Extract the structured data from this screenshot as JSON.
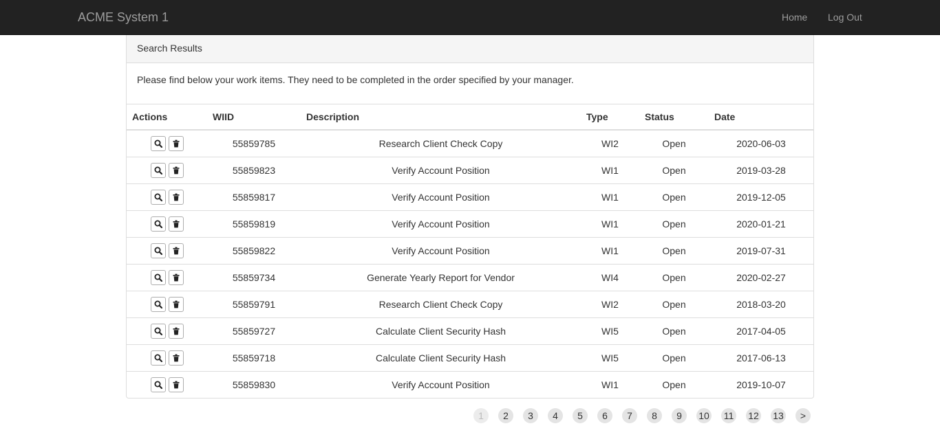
{
  "navbar": {
    "brand": "ACME System 1",
    "links": [
      {
        "label": "Home"
      },
      {
        "label": "Log Out"
      }
    ]
  },
  "panel": {
    "heading": "Search Results",
    "body_text": "Please find below your work items. They need to be completed in the order specified by your manager."
  },
  "table": {
    "columns": [
      "Actions",
      "WIID",
      "Description",
      "Type",
      "Status",
      "Date"
    ],
    "rows": [
      {
        "wiid": "55859785",
        "description": "Research Client Check Copy",
        "type": "WI2",
        "status": "Open",
        "date": "2020-06-03"
      },
      {
        "wiid": "55859823",
        "description": "Verify Account Position",
        "type": "WI1",
        "status": "Open",
        "date": "2019-03-28"
      },
      {
        "wiid": "55859817",
        "description": "Verify Account Position",
        "type": "WI1",
        "status": "Open",
        "date": "2019-12-05"
      },
      {
        "wiid": "55859819",
        "description": "Verify Account Position",
        "type": "WI1",
        "status": "Open",
        "date": "2020-01-21"
      },
      {
        "wiid": "55859822",
        "description": "Verify Account Position",
        "type": "WI1",
        "status": "Open",
        "date": "2019-07-31"
      },
      {
        "wiid": "55859734",
        "description": "Generate Yearly Report for Vendor",
        "type": "WI4",
        "status": "Open",
        "date": "2020-02-27"
      },
      {
        "wiid": "55859791",
        "description": "Research Client Check Copy",
        "type": "WI2",
        "status": "Open",
        "date": "2018-03-20"
      },
      {
        "wiid": "55859727",
        "description": "Calculate Client Security Hash",
        "type": "WI5",
        "status": "Open",
        "date": "2017-04-05"
      },
      {
        "wiid": "55859718",
        "description": "Calculate Client Security Hash",
        "type": "WI5",
        "status": "Open",
        "date": "2017-06-13"
      },
      {
        "wiid": "55859830",
        "description": "Verify Account Position",
        "type": "WI1",
        "status": "Open",
        "date": "2019-10-07"
      }
    ]
  },
  "pagination": {
    "pages": [
      "1",
      "2",
      "3",
      "4",
      "5",
      "6",
      "7",
      "8",
      "9",
      "10",
      "11",
      "12",
      "13",
      ">"
    ],
    "active": "1"
  },
  "icons": {
    "view": "search-icon",
    "delete": "trash-icon"
  }
}
